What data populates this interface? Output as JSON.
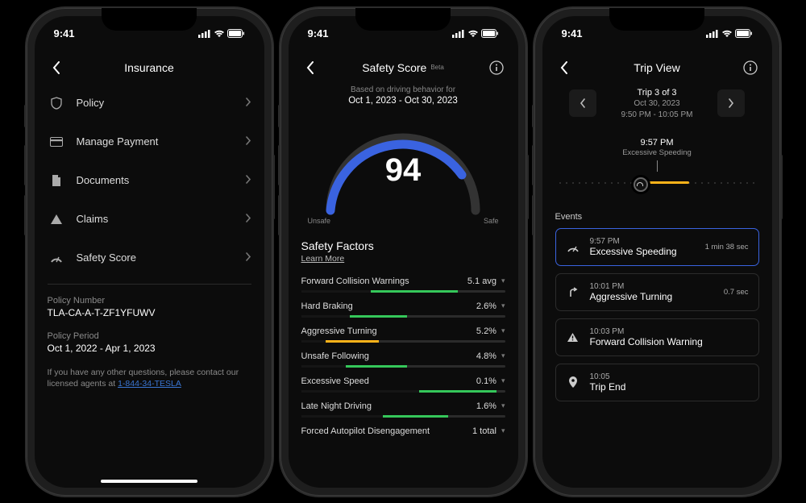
{
  "status": {
    "time": "9:41"
  },
  "screens": {
    "insurance": {
      "title": "Insurance",
      "menu": [
        {
          "id": "policy",
          "label": "Policy"
        },
        {
          "id": "payment",
          "label": "Manage Payment"
        },
        {
          "id": "docs",
          "label": "Documents"
        },
        {
          "id": "claims",
          "label": "Claims"
        },
        {
          "id": "safety",
          "label": "Safety Score"
        }
      ],
      "policy_number_label": "Policy Number",
      "policy_number": "TLA-CA-A-T-ZF1YFUWV",
      "policy_period_label": "Policy Period",
      "policy_period": "Oct 1, 2022 - Apr 1, 2023",
      "footnote": "If you have any other questions, please contact our licensed agents at ",
      "phone": "1-844-34-TESLA"
    },
    "safety": {
      "title": "Safety Score",
      "beta": "Beta",
      "based": "Based on driving behavior for",
      "range": "Oct 1, 2023 - Oct 30, 2023",
      "score": "94",
      "unsafe_label": "Unsafe",
      "safe_label": "Safe",
      "factors_heading": "Safety Factors",
      "learn_more": "Learn More",
      "factors": [
        {
          "name": "Forward Collision Warnings",
          "value": "5.1 avg",
          "color": "#35c75a",
          "fill": 77,
          "dark_from": 0,
          "dark_to": 34
        },
        {
          "name": "Hard Braking",
          "value": "2.6%",
          "color": "#35c75a",
          "fill": 52,
          "dark_from": 0,
          "dark_to": 24
        },
        {
          "name": "Aggressive Turning",
          "value": "5.2%",
          "color": "#ffb31a",
          "fill": 38,
          "dark_from": 0,
          "dark_to": 12
        },
        {
          "name": "Unsafe Following",
          "value": "4.8%",
          "color": "#35c75a",
          "fill": 52,
          "dark_from": 0,
          "dark_to": 22
        },
        {
          "name": "Excessive Speed",
          "value": "0.1%",
          "color": "#35c75a",
          "fill": 96,
          "dark_from": 0,
          "dark_to": 58
        },
        {
          "name": "Late Night Driving",
          "value": "1.6%",
          "color": "#35c75a",
          "fill": 72,
          "dark_from": 0,
          "dark_to": 40
        },
        {
          "name": "Forced Autopilot Disengagement",
          "value": "1 total",
          "color": "#35c75a",
          "fill": 0,
          "dark_from": 0,
          "dark_to": 0
        }
      ]
    },
    "trip": {
      "title": "Trip View",
      "trip_of": "Trip 3 of 3",
      "trip_date": "Oct 30, 2023",
      "trip_time": "9:50 PM - 10:05 PM",
      "highlight_time": "9:57 PM",
      "highlight_label": "Excessive Speeding",
      "events_heading": "Events",
      "events": [
        {
          "time": "9:57 PM",
          "name": "Excessive Speeding",
          "dur": "1 min 38 sec",
          "selected": true,
          "icon": "speed"
        },
        {
          "time": "10:01 PM",
          "name": "Aggressive Turning",
          "dur": "0.7 sec",
          "selected": false,
          "icon": "turn"
        },
        {
          "time": "10:03 PM",
          "name": "Forward Collision Warning",
          "dur": "",
          "selected": false,
          "icon": "warn"
        },
        {
          "time": "10:05",
          "name": "Trip End",
          "dur": "",
          "selected": false,
          "icon": "pin"
        }
      ]
    }
  }
}
